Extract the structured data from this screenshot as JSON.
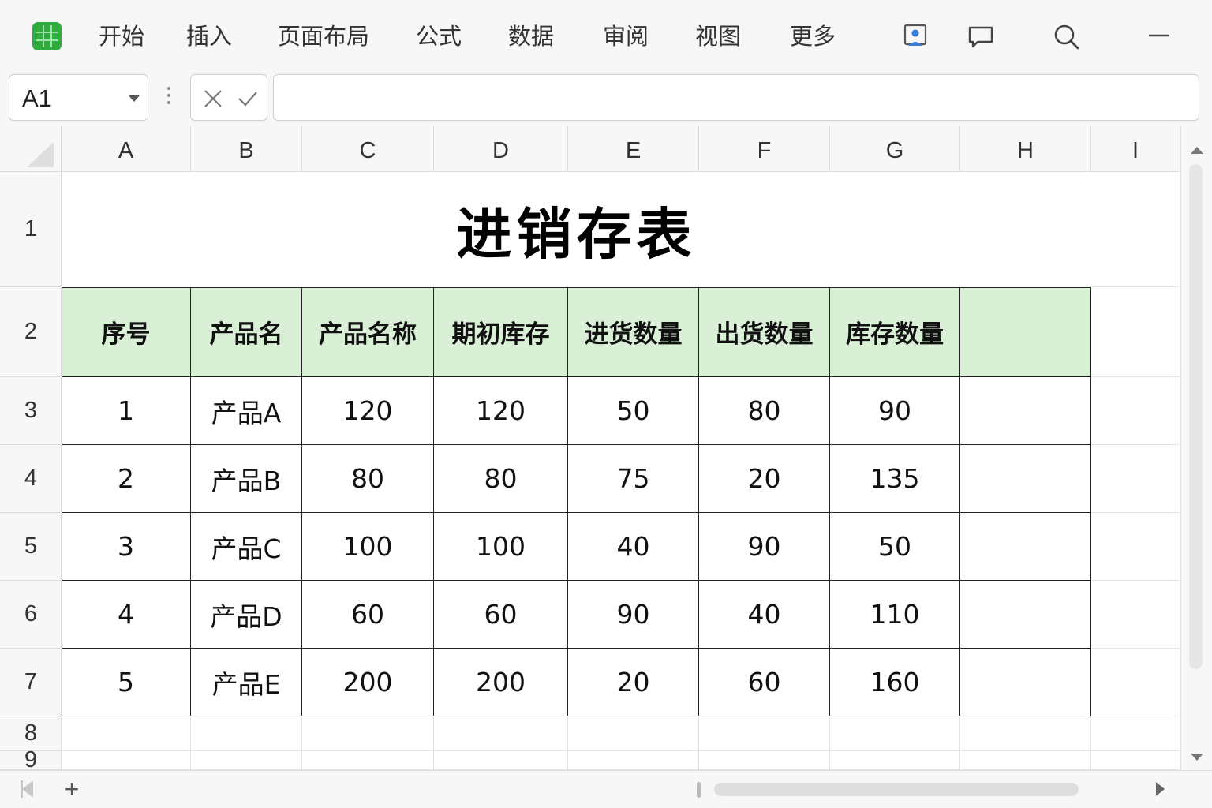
{
  "menu": {
    "items": [
      "开始",
      "插入",
      "页面布局",
      "公式",
      "数据",
      "审阅",
      "视图",
      "更多"
    ],
    "icons": [
      "collab-icon",
      "comment-icon",
      "search-icon",
      "minimize-icon"
    ]
  },
  "formula_bar": {
    "cell_ref": "A1",
    "formula": ""
  },
  "grid": {
    "columns": [
      "A",
      "B",
      "C",
      "D",
      "E",
      "F",
      "G",
      "H",
      "I"
    ],
    "rows": [
      "1",
      "2",
      "3",
      "4",
      "5",
      "6",
      "7",
      "8",
      "9"
    ]
  },
  "sheet": {
    "title": "进销存表",
    "header_color": "#d9efd6",
    "headers": [
      "序号",
      "产品名",
      "产品名称",
      "期初库存",
      "进货数量",
      "出货数量",
      "库存数量",
      ""
    ],
    "rows": [
      [
        "1",
        "产品A",
        "120",
        "120",
        "50",
        "80",
        "90",
        ""
      ],
      [
        "2",
        "产品B",
        "80",
        "80",
        "75",
        "20",
        "135",
        ""
      ],
      [
        "3",
        "产品C",
        "100",
        "100",
        "40",
        "90",
        "50",
        ""
      ],
      [
        "4",
        "产品D",
        "60",
        "60",
        "90",
        "40",
        "110",
        ""
      ],
      [
        "5",
        "产品E",
        "200",
        "200",
        "20",
        "60",
        "160",
        ""
      ]
    ]
  },
  "bottom": {
    "add_sheet": "+"
  },
  "colors": {
    "app_green": "#2fae3f",
    "header_fill": "#d9efd6",
    "chrome": "#f7f7f7"
  }
}
